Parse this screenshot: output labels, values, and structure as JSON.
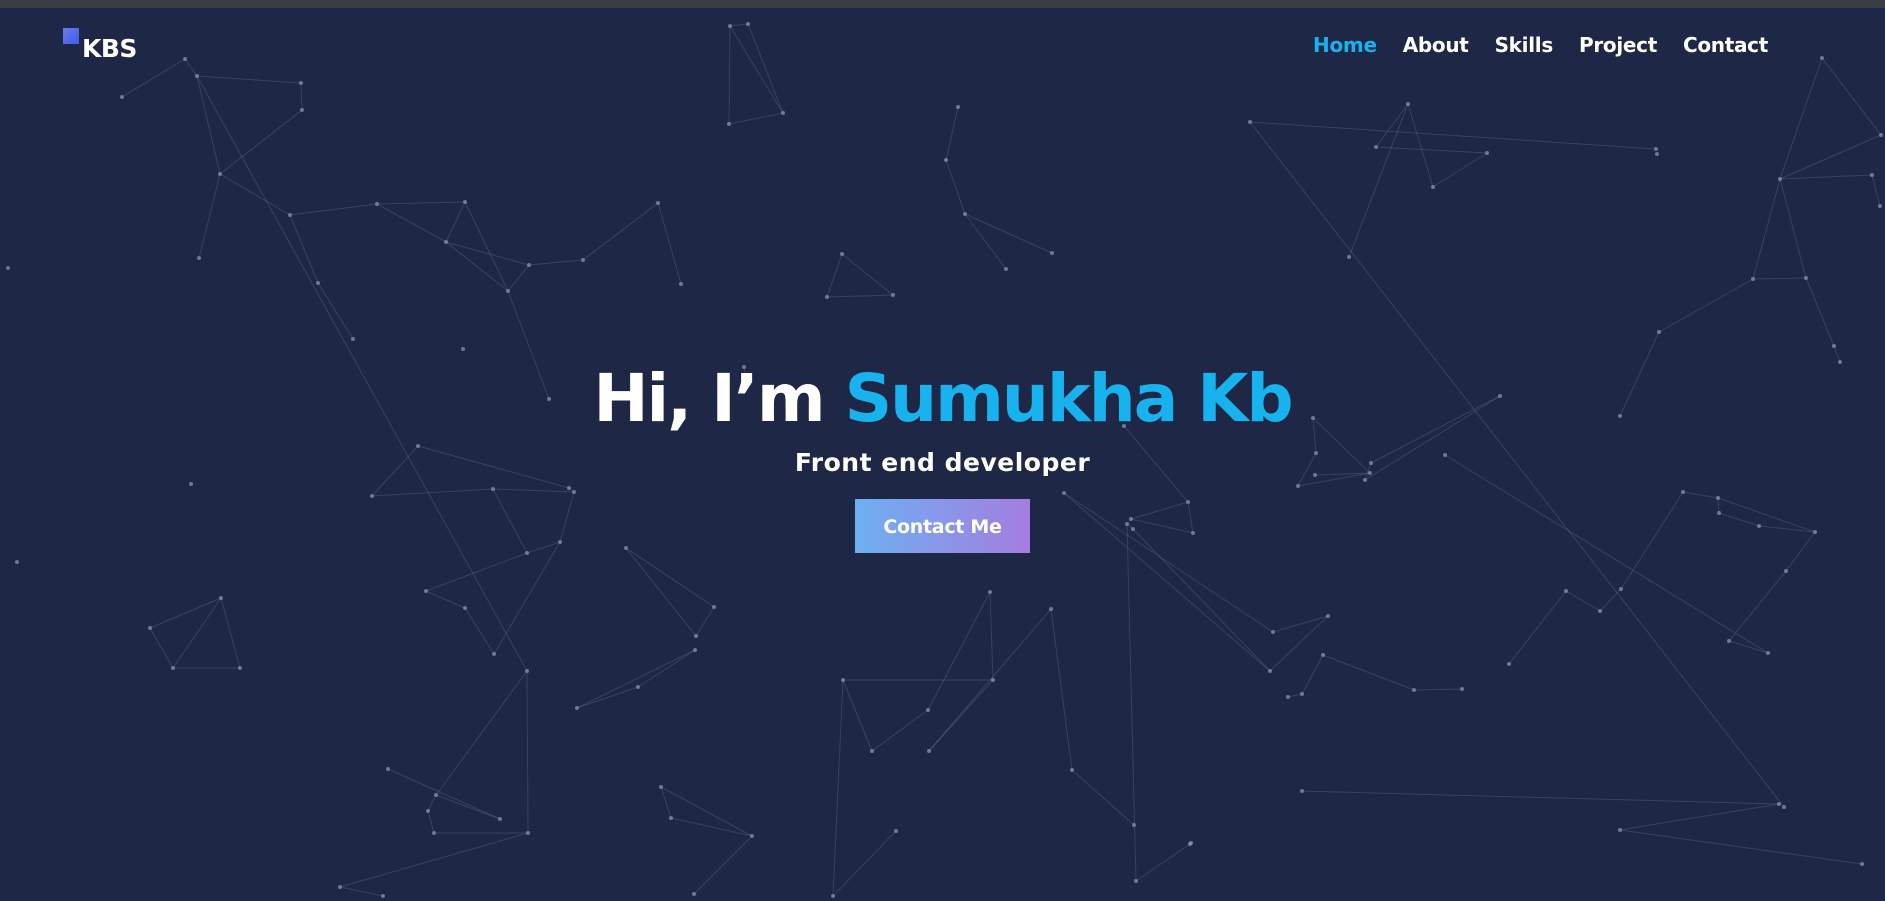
{
  "header": {
    "logo_text": "KBS",
    "logo_icon": "square-logo-icon"
  },
  "nav": {
    "items": [
      {
        "label": "Home",
        "active": true
      },
      {
        "label": "About",
        "active": false
      },
      {
        "label": "Skills",
        "active": false
      },
      {
        "label": "Project",
        "active": false
      },
      {
        "label": "Contact",
        "active": false
      }
    ]
  },
  "hero": {
    "greeting": "Hi, I’m",
    "name": "Sumukha Kb",
    "subtitle": "Front end developer",
    "cta_label": "Contact Me"
  },
  "colors": {
    "background": "#1e2745",
    "accent": "#18b3ee",
    "text": "#ffffff",
    "button_gradient_start": "#6eb0f2",
    "button_gradient_end": "#a47de0",
    "particle": "#8a93a8"
  }
}
